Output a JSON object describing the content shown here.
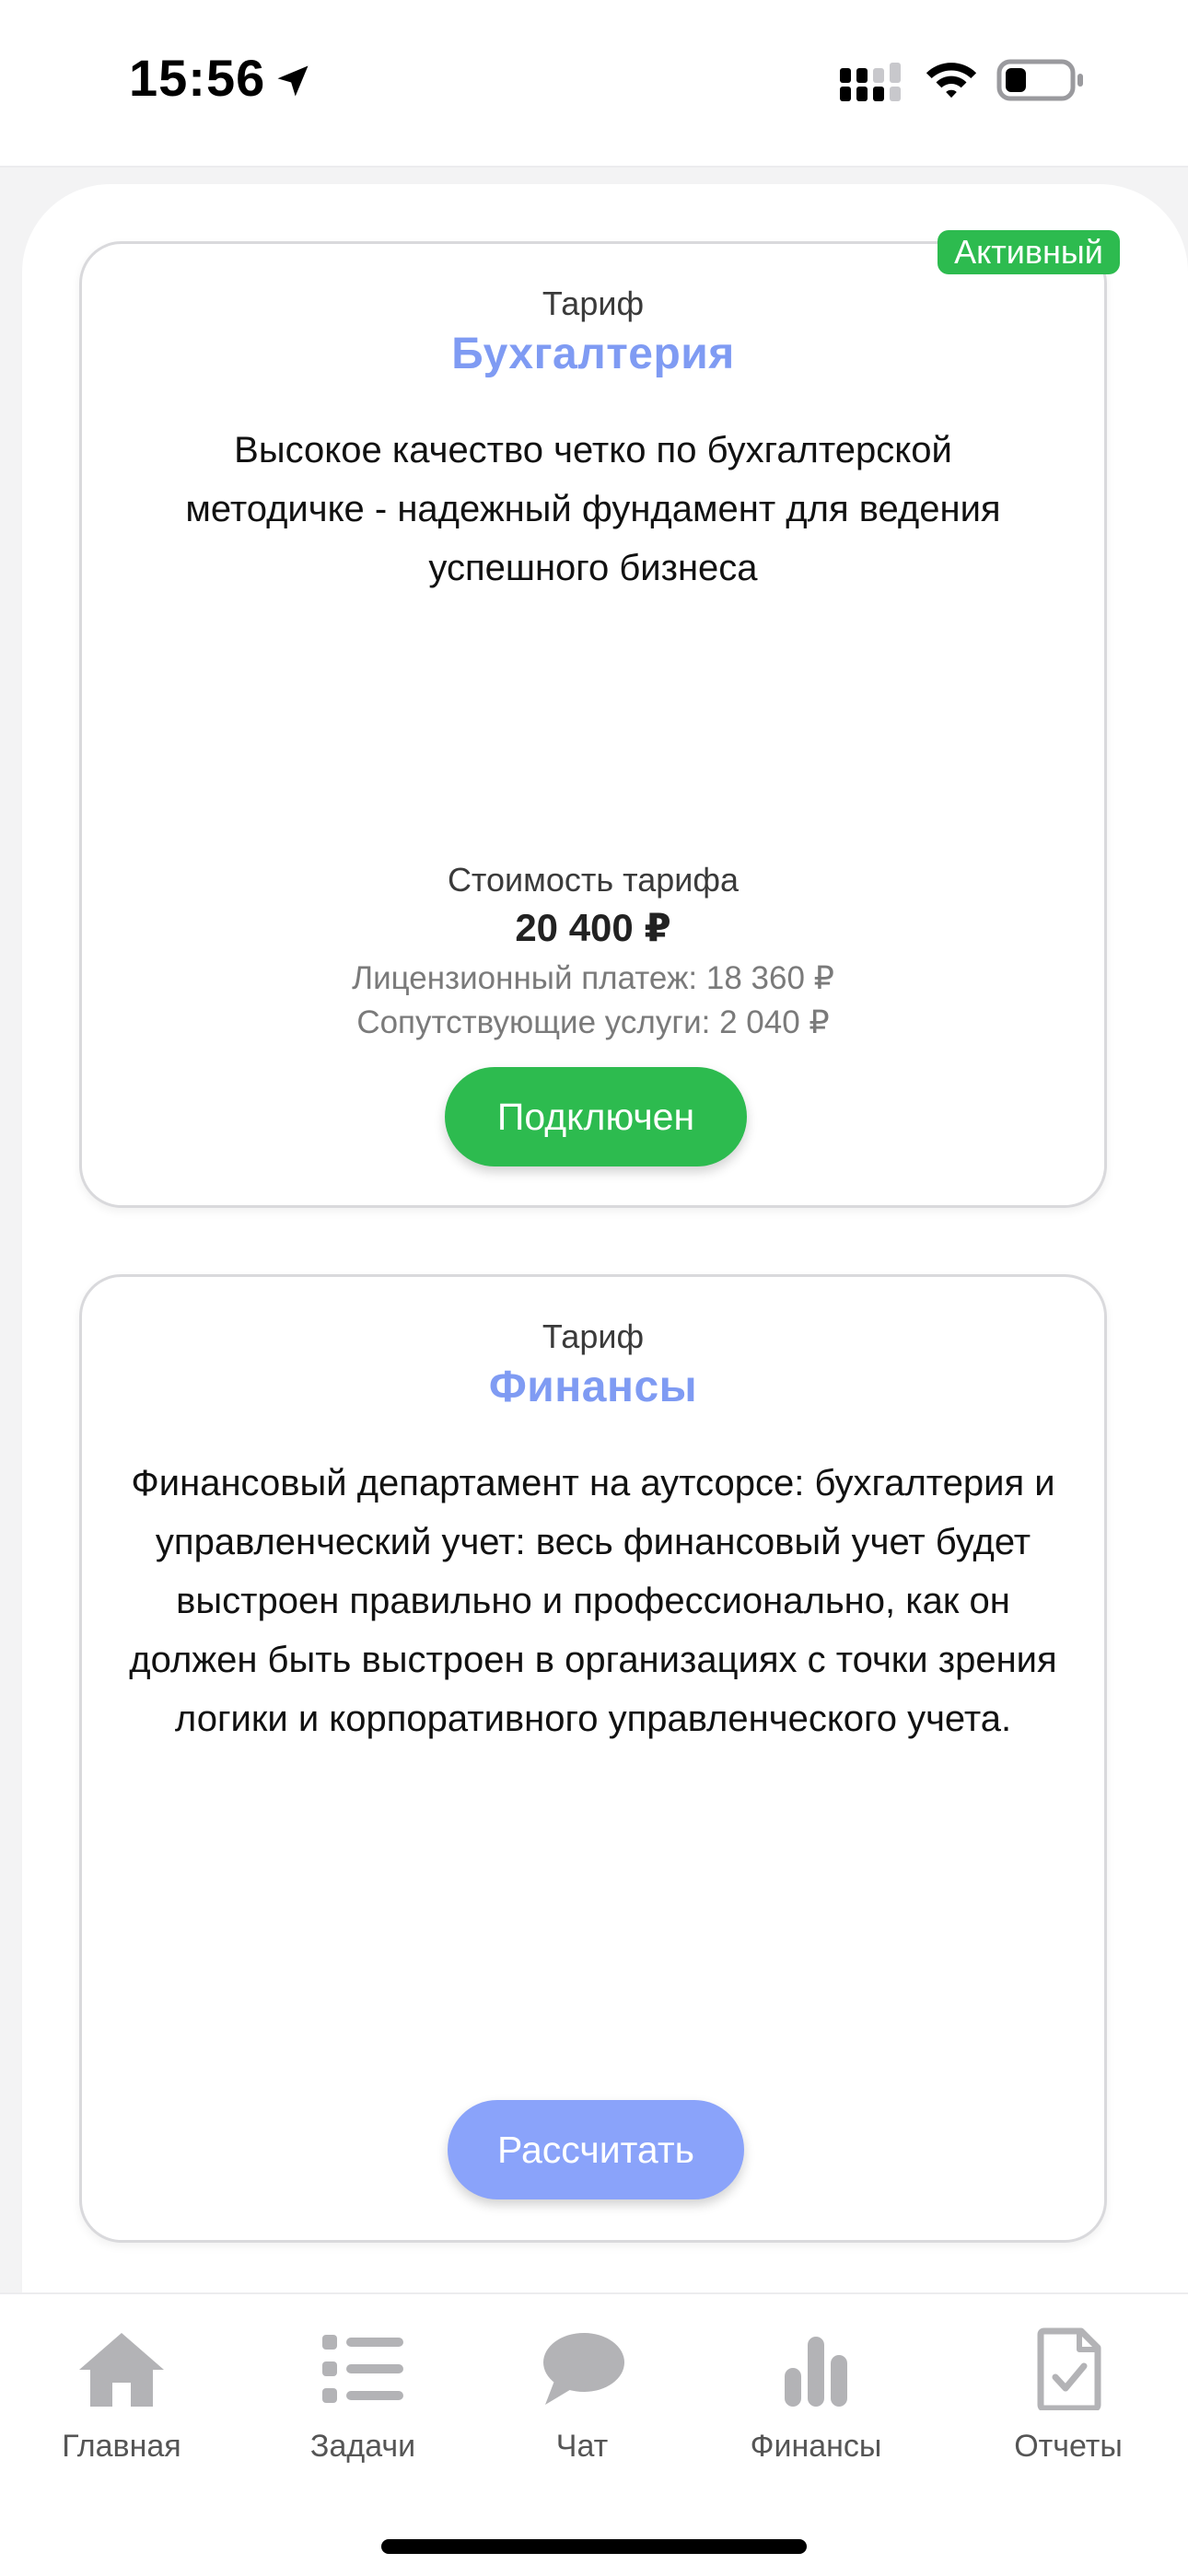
{
  "status_bar": {
    "time": "15:56"
  },
  "tariffs": [
    {
      "badge": "Активный",
      "kicker": "Тариф",
      "name": "Бухгалтерия",
      "description": "Высокое качество четко по бухгалтерской методичке - надежный фундамент для ведения успешного бизнеса",
      "price_caption": "Стоимость тарифа",
      "price": "20 400 ₽",
      "license_fee": "Лицензионный платеж: 18 360 ₽",
      "related_services": "Сопутствующие услуги: 2 040 ₽",
      "button_label": "Подключен"
    },
    {
      "kicker": "Тариф",
      "name": "Финансы",
      "description": "Финансовый департамент на аутсорсе: бухгалтерия и управленческий учет: весь финансовый учет будет выстроен правильно и профессионально, как он должен быть выстроен в организациях с точки зрения логики и корпоративного управленческого учета.",
      "button_label": "Рассчитать"
    }
  ],
  "tab_bar": {
    "items": [
      {
        "label": "Главная",
        "icon": "home-icon"
      },
      {
        "label": "Задачи",
        "icon": "list-icon"
      },
      {
        "label": "Чат",
        "icon": "chat-bubble-icon"
      },
      {
        "label": "Финансы",
        "icon": "bar-chart-icon"
      },
      {
        "label": "Отчеты",
        "icon": "report-document-icon"
      }
    ]
  },
  "colors": {
    "accent_blue": "#7f9bf3",
    "button_blue": "#8aa3fa",
    "success_green": "#2dbb4f",
    "tab_icon_gray": "#b3b3b6"
  }
}
